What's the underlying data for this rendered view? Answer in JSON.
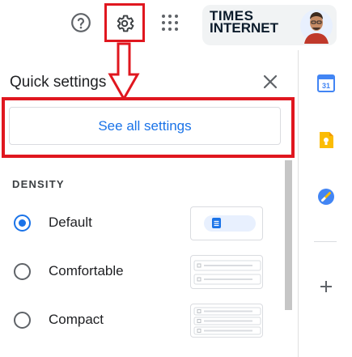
{
  "header": {
    "help_icon": "help-circle-icon",
    "settings_icon": "gear-icon",
    "apps_icon": "apps-grid-icon",
    "brand": {
      "line1": "TIMES",
      "line2": "INTERNET"
    }
  },
  "quick_settings": {
    "title": "Quick settings",
    "close_icon": "close-icon",
    "see_all_label": "See all settings",
    "density": {
      "heading": "DENSITY",
      "options": [
        {
          "label": "Default",
          "selected": true
        },
        {
          "label": "Comfortable",
          "selected": false
        },
        {
          "label": "Compact",
          "selected": false
        }
      ]
    }
  },
  "right_rail": {
    "items": [
      "calendar-icon",
      "keep-icon",
      "tasks-icon",
      "add-icon"
    ],
    "calendar_day": "31"
  },
  "colors": {
    "highlight": "#e0171f",
    "accent": "#1a73e8",
    "keep": "#fbbc04"
  }
}
